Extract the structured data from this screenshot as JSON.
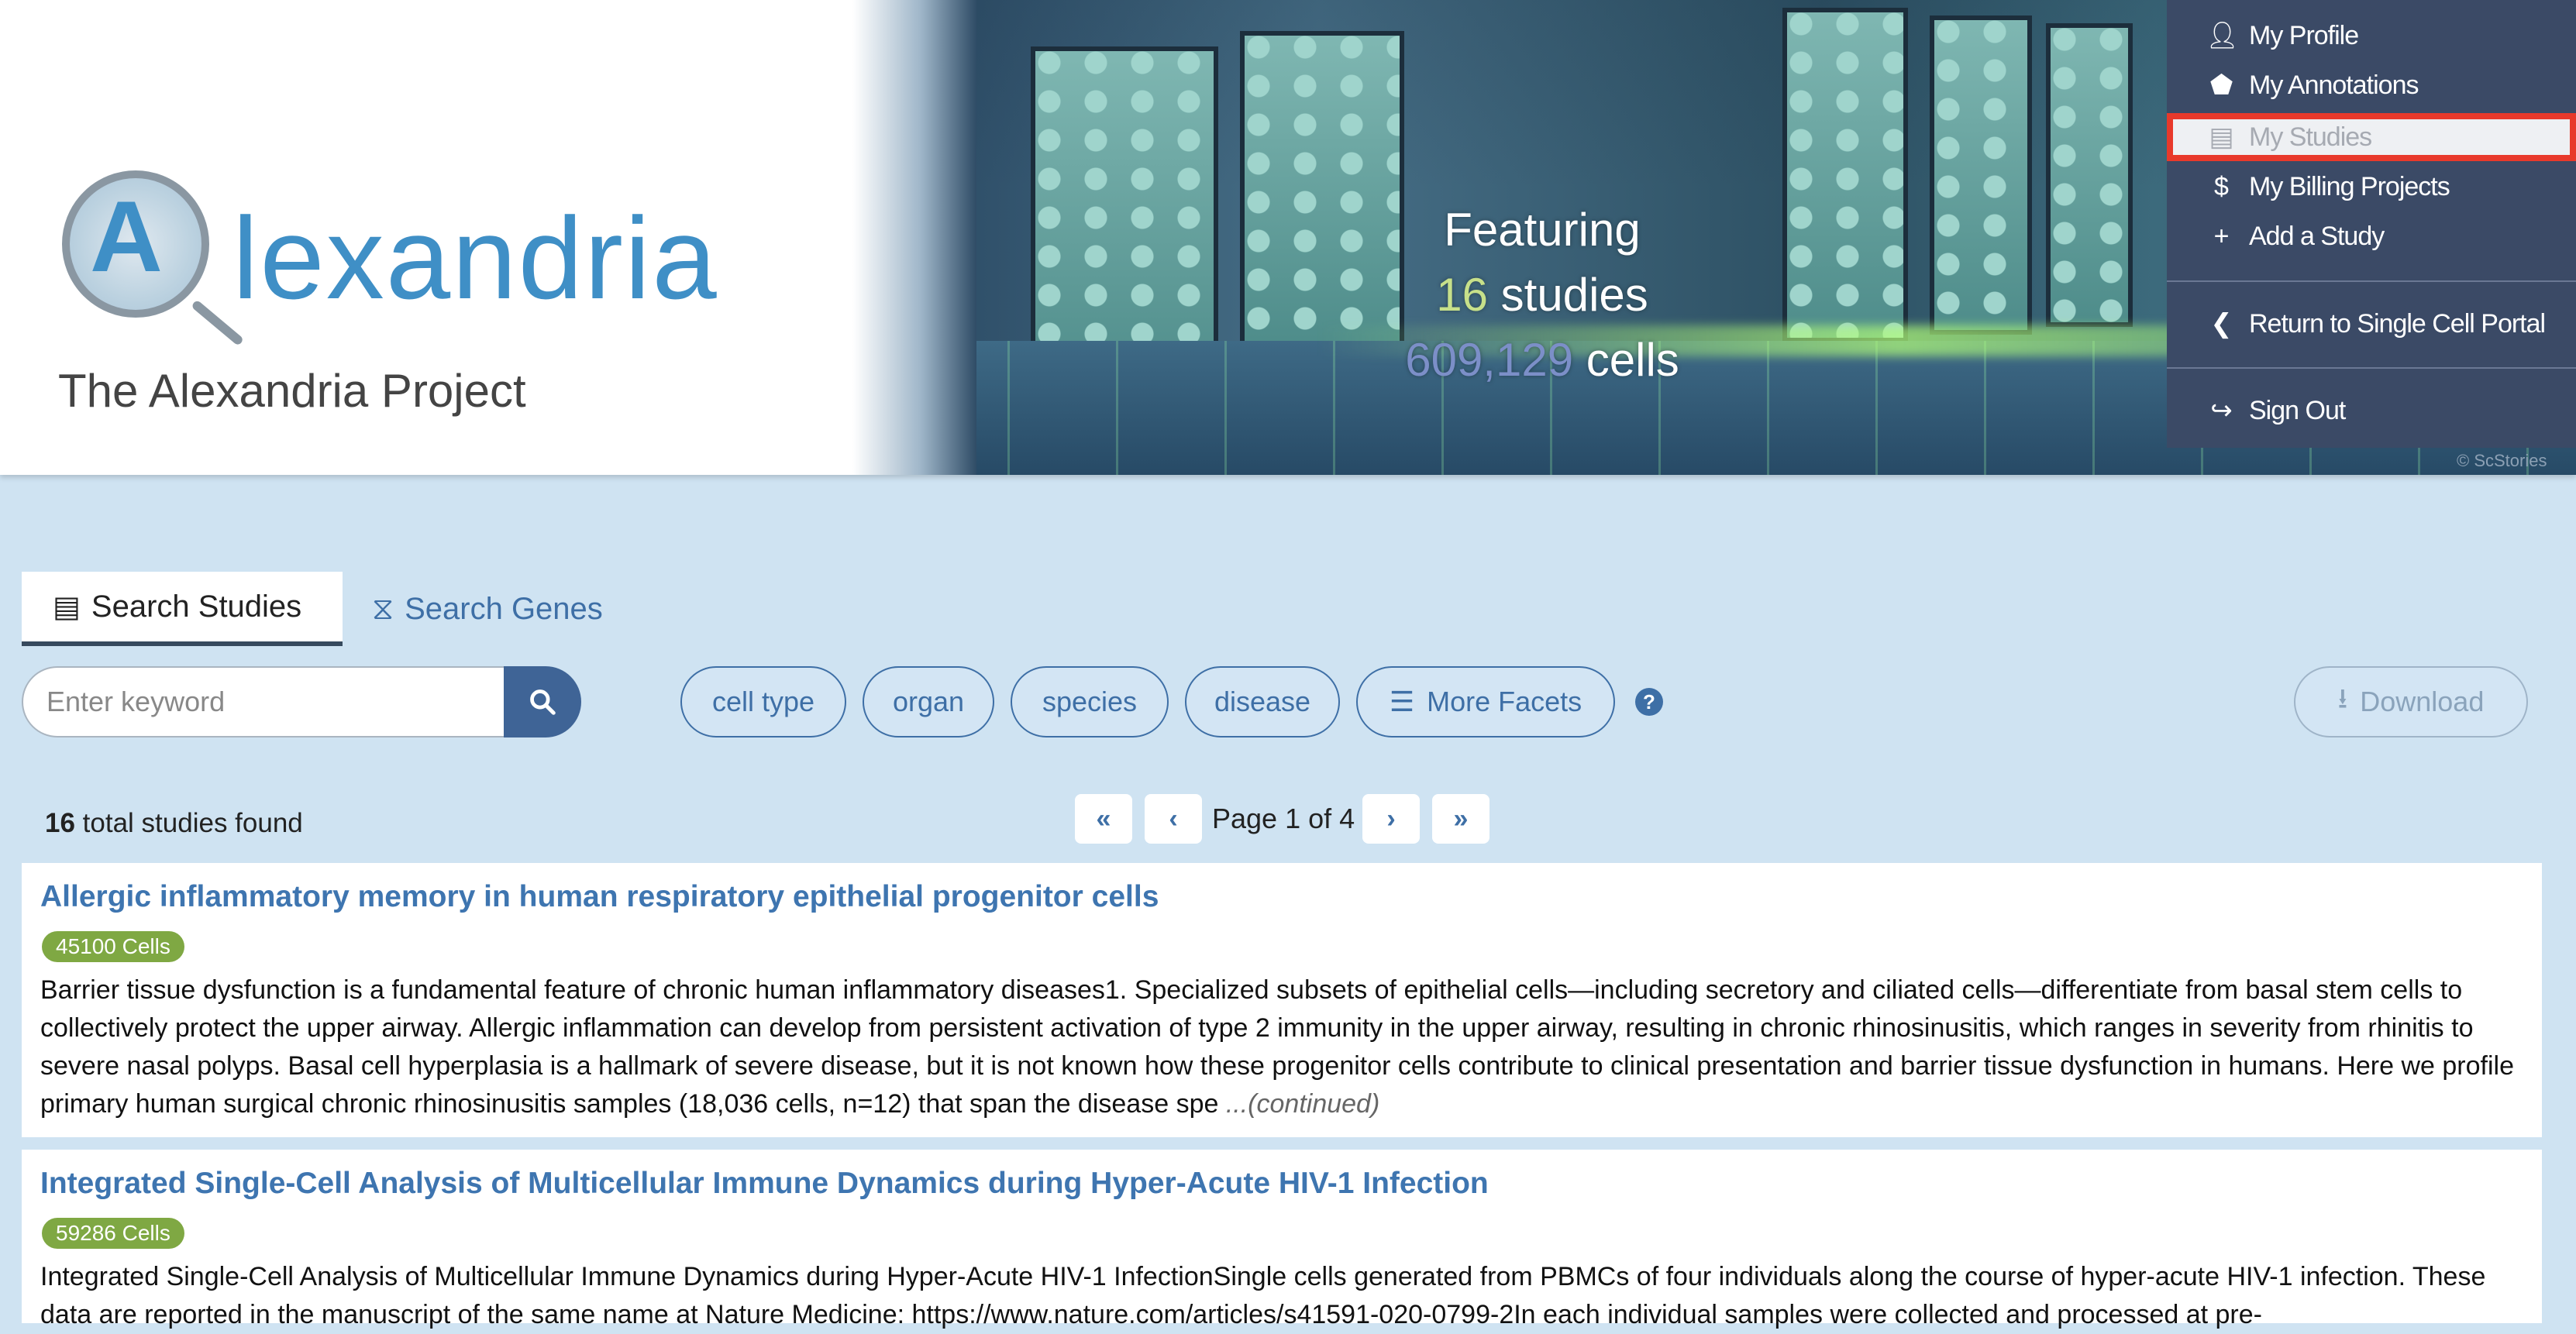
{
  "header": {
    "logo_text": "lexandria",
    "tagline": "The Alexandria Project",
    "featuring": "Featuring",
    "studies_count": "16",
    "studies_label": "studies",
    "cells_count": "609,129",
    "cells_label": "cells",
    "image_credit": "© ScStories"
  },
  "user_menu": {
    "items": [
      {
        "label": "My Profile",
        "icon": "user-icon"
      },
      {
        "label": "My Annotations",
        "icon": "tags-icon"
      },
      {
        "label": "My Studies",
        "icon": "book-icon",
        "state": "selected"
      },
      {
        "label": "My Billing Projects",
        "icon": "dollar-icon"
      },
      {
        "label": "Add a Study",
        "icon": "plus-icon"
      },
      {
        "label": "Return to Single Cell Portal",
        "icon": "chevron-left-circle-icon"
      },
      {
        "label": "Sign Out",
        "icon": "sign-out-icon"
      }
    ]
  },
  "tabs": {
    "search_studies": "Search Studies",
    "search_genes": "Search Genes"
  },
  "search": {
    "placeholder": "Enter keyword",
    "value": ""
  },
  "facets": {
    "items": [
      "cell type",
      "organ",
      "species",
      "disease"
    ],
    "more": "More Facets"
  },
  "download_label": "Download",
  "results": {
    "total_count": "16",
    "total_suffix": "total studies found",
    "page_label": "Page 1 of 4"
  },
  "studies": [
    {
      "title": "Allergic inflammatory memory in human respiratory epithelial progenitor cells",
      "cells": "45100 Cells",
      "description": "Barrier tissue dysfunction is a fundamental feature of chronic human inflammatory diseases1. Specialized subsets of epithelial cells—including secretory and ciliated cells—differentiate from basal stem cells to collectively protect the upper airway. Allergic inflammation can develop from persistent activation of type 2 immunity in the upper airway, resulting in chronic rhinosinusitis, which ranges in severity from rhinitis to severe nasal polyps. Basal cell hyperplasia is a hallmark of severe disease, but it is not known how these progenitor cells contribute to clinical presentation and barrier tissue dysfunction in humans. Here we profile primary human surgical chronic rhinosinusitis samples (18,036 cells, n=12) that span the disease spe",
      "continued": "...(continued)"
    },
    {
      "title": "Integrated Single-Cell Analysis of Multicellular Immune Dynamics during Hyper-Acute HIV-1 Infection",
      "cells": "59286 Cells",
      "description": "Integrated Single-Cell Analysis of Multicellular Immune Dynamics during Hyper-Acute HIV-1 InfectionSingle cells generated from PBMCs of four individuals along the course of hyper-acute HIV-1 infection. These data are reported in the manuscript of the same name at Nature Medicine: https://www.nature.com/articles/s41591-020-0799-2In each individual samples were collected and processed at pre-"
    }
  ],
  "colors": {
    "link_blue": "#3e75b0",
    "badge_green": "#7fa843",
    "menu_bg": "#3b4a66",
    "highlight_red": "#e8392b",
    "page_bg": "#cfe3f2"
  }
}
